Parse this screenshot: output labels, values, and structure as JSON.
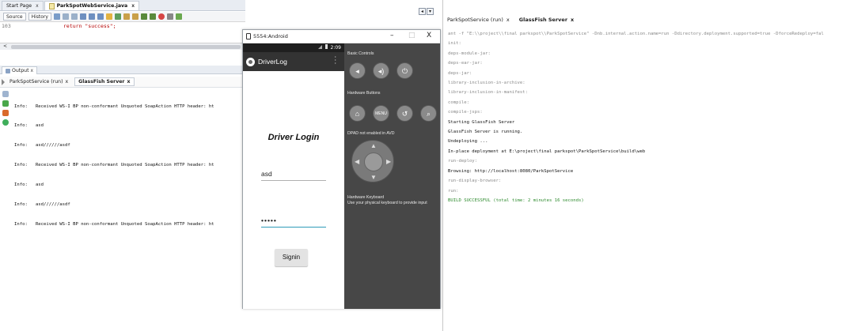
{
  "editor": {
    "tabs": [
      {
        "label": "Start Page"
      },
      {
        "label": "ParkSpotWebService.java"
      }
    ],
    "toolbar": {
      "source_label": "Source",
      "history_label": "History"
    },
    "line_number": "103",
    "code_line": "return \"success\";",
    "scroll_left": "<"
  },
  "output": {
    "title": "Output",
    "tabs": [
      {
        "label": "ParkSpotService (run)"
      },
      {
        "label": "GlassFish Server"
      }
    ],
    "log": [
      "Info:   Received WS-I BP non-conformant Unquoted SoapAction HTTP header: ht",
      "Info:   asd",
      "Info:   asd//////asdf",
      "Info:   Received WS-I BP non-conformant Unquoted SoapAction HTTP header: ht",
      "Info:   asd",
      "Info:   asd//////asdf",
      "Info:   Received WS-I BP non-conformant Unquoted SoapAction HTTP header: ht"
    ]
  },
  "emulator": {
    "window_title": "5554:Android",
    "controls": {
      "minimize": "–",
      "maximize": "□",
      "close": "X"
    },
    "status_time": "2:09",
    "app_title": "DriverLog",
    "login_title": "Driver Login",
    "username_value": "asd",
    "password_value": "•••••",
    "signin_label": "Signin",
    "labels": {
      "basic_controls": "Basic Controls",
      "hardware_buttons": "Hardware Buttons",
      "dpad": "DPAD not enabled in AVD",
      "keyboard_title": "Hardware Keyboard",
      "keyboard_hint": "Use your physical keyboard to provide input"
    },
    "menu_label": "MENU"
  },
  "right_pane": {
    "tabs": [
      {
        "label": "ParkSpotService (run)"
      },
      {
        "label": "GlassFish Server"
      }
    ],
    "log": [
      {
        "text": "ant -f \"E:\\\\project\\\\final parkspot\\\\ParkSpotService\" -Dnb.internal.action.name=run -Ddirectory.deployment.supported=true -DforceRedeploy=fal",
        "style": "dim"
      },
      {
        "text": "init:",
        "style": "dim"
      },
      {
        "text": "deps-module-jar:",
        "style": "dim"
      },
      {
        "text": "deps-ear-jar:",
        "style": "dim"
      },
      {
        "text": "deps-jar:",
        "style": "dim"
      },
      {
        "text": "library-inclusion-in-archive:",
        "style": "dim"
      },
      {
        "text": "library-inclusion-in-manifest:",
        "style": "dim"
      },
      {
        "text": "compile:",
        "style": "dim"
      },
      {
        "text": "compile-jsps:",
        "style": "dim"
      },
      {
        "text": "Starting GlassFish Server",
        "style": "norm"
      },
      {
        "text": "GlassFish Server is running.",
        "style": "norm"
      },
      {
        "text": "Undeploying ...",
        "style": "norm"
      },
      {
        "text": "In-place deployment at E:\\project\\final parkspot\\ParkSpotService\\build\\web",
        "style": "norm"
      },
      {
        "text": "run-deploy:",
        "style": "dim"
      },
      {
        "text": "Browsing: http://localhost:8080/ParkSpotService",
        "style": "norm"
      },
      {
        "text": "run-display-browser:",
        "style": "dim"
      },
      {
        "text": "run:",
        "style": "dim"
      },
      {
        "text": "BUILD SUCCESSFUL (total time: 2 minutes 16 seconds)",
        "style": "ok"
      }
    ]
  },
  "colors": {
    "success": "#2e8b2e",
    "emulator_panel": "#474747",
    "focus_underline": "#2f9bb8"
  }
}
